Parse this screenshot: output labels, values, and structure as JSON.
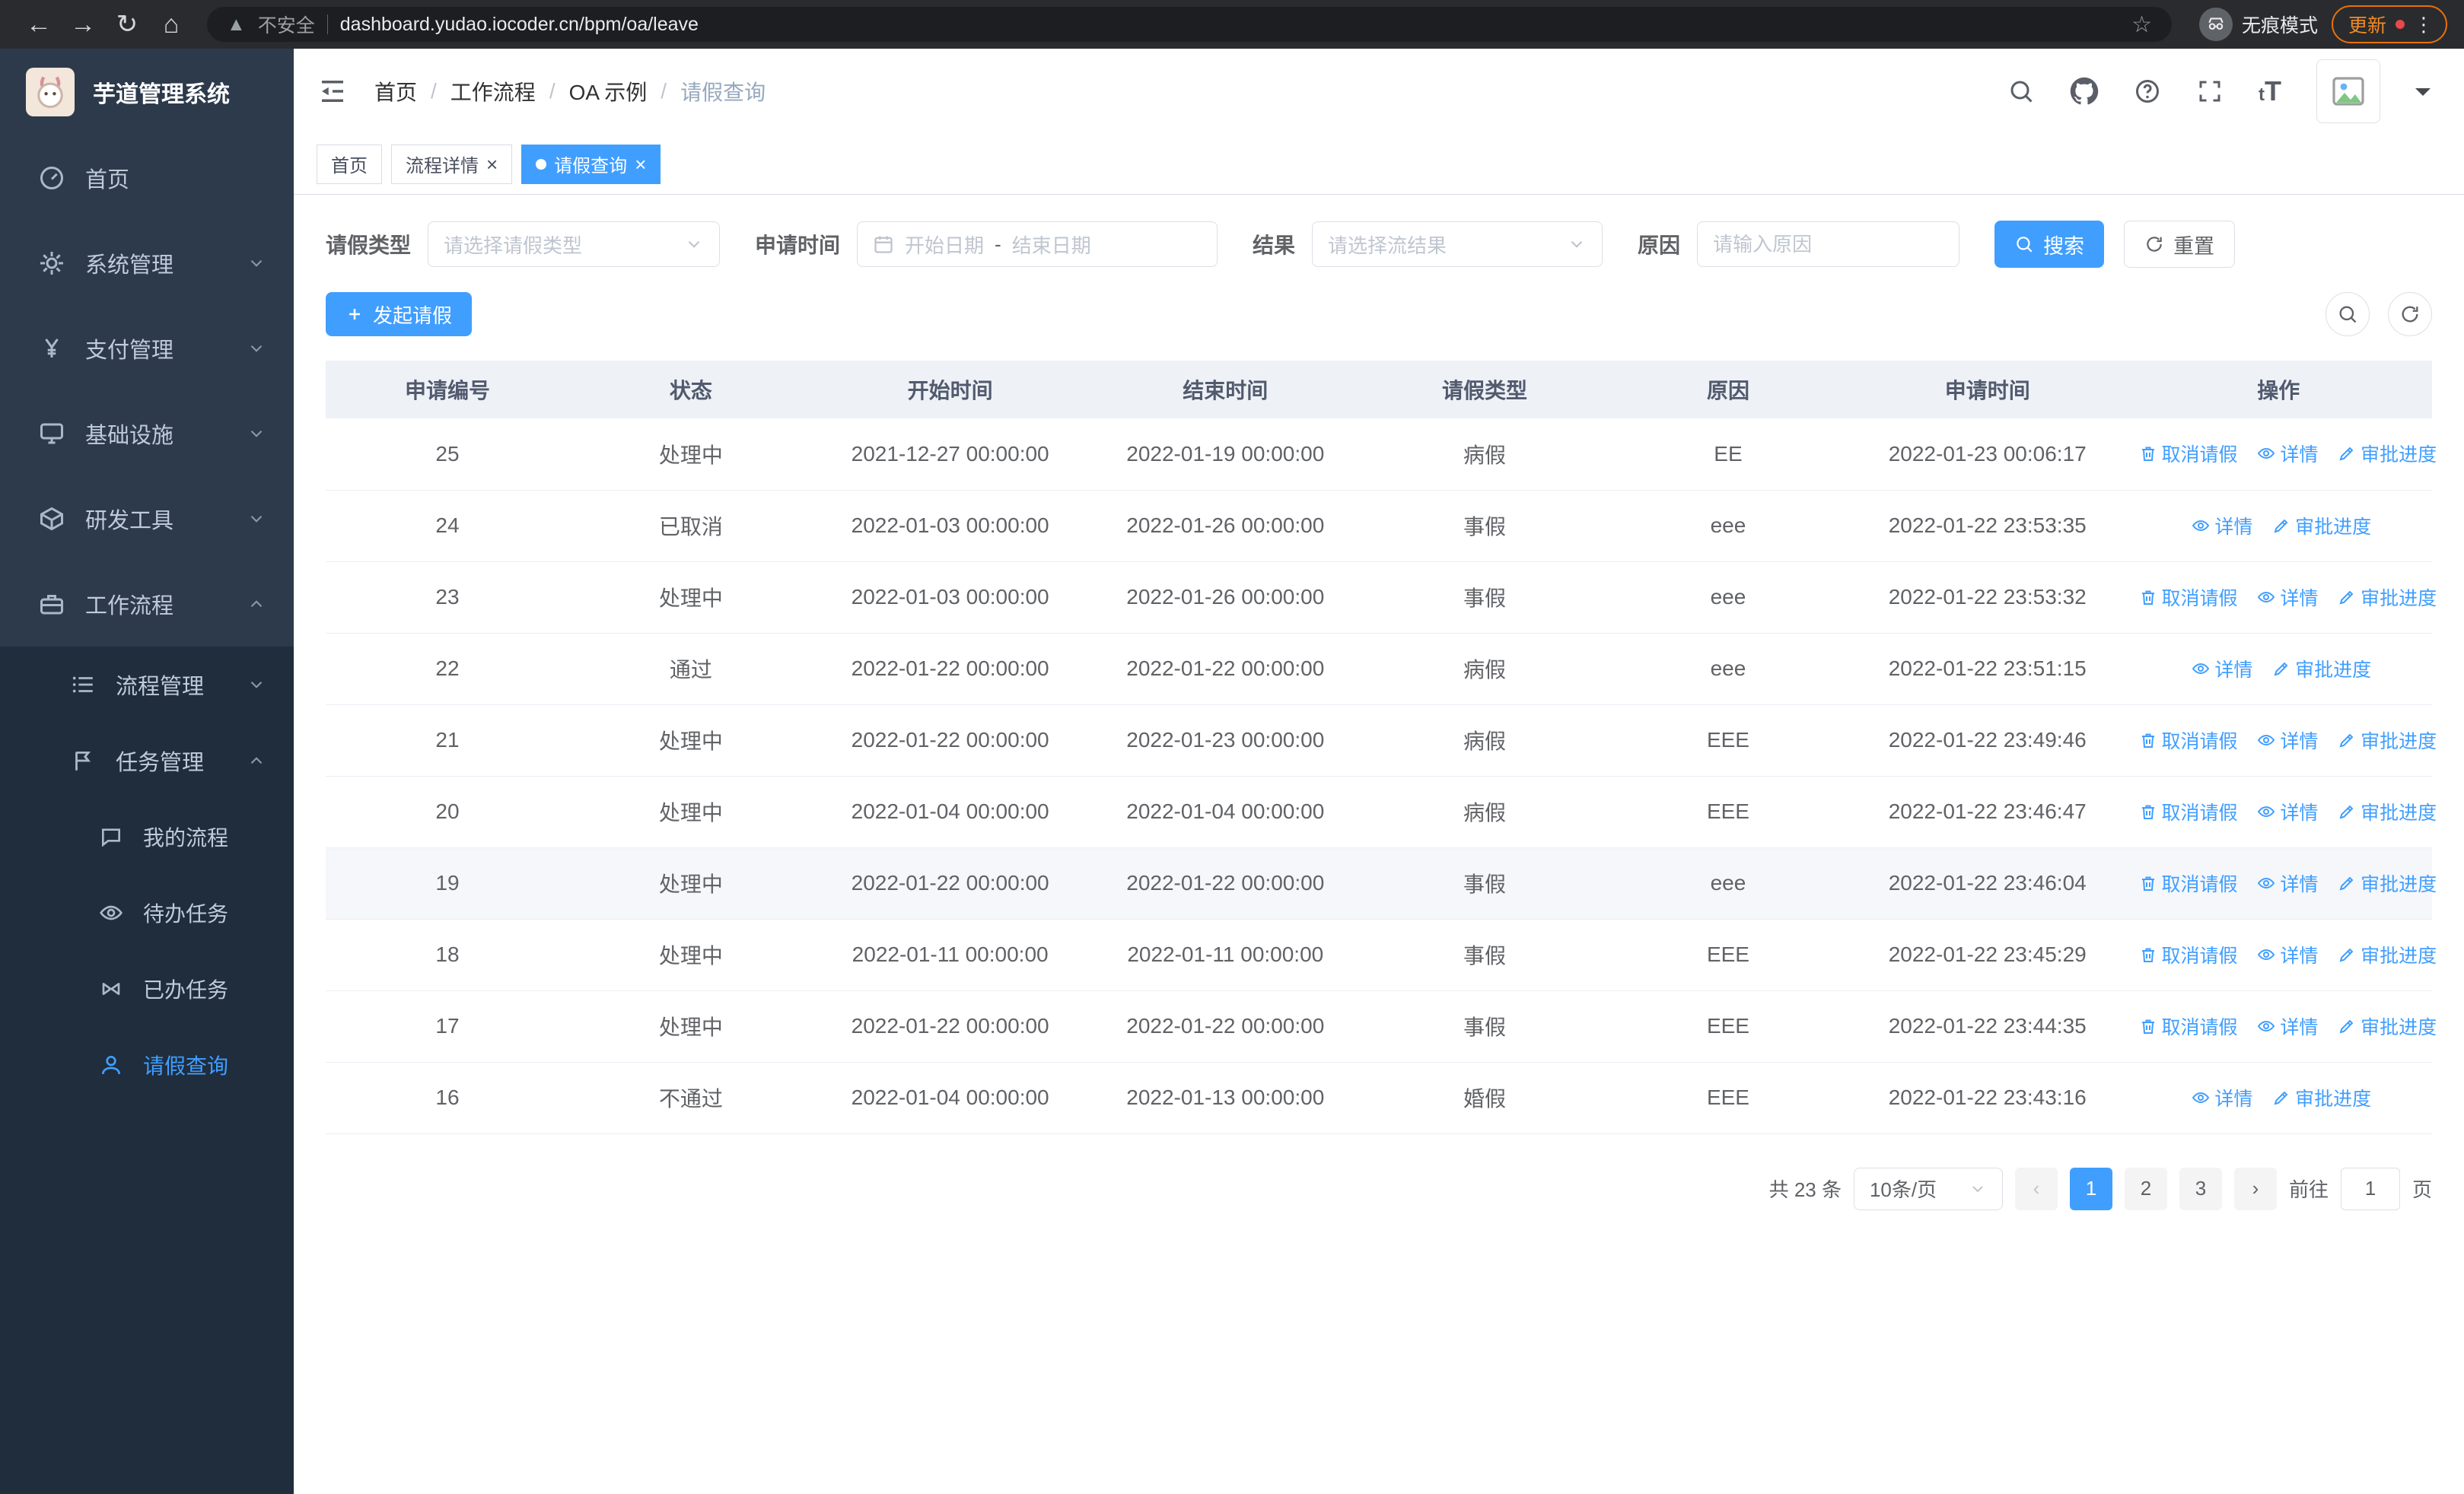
{
  "browser": {
    "security_label": "不安全",
    "url": "dashboard.yudao.iocoder.cn/bpm/oa/leave",
    "incognito_label": "无痕模式",
    "update_label": "更新"
  },
  "sidebar": {
    "app_title": "芋道管理系统",
    "items": [
      {
        "label": "首页"
      },
      {
        "label": "系统管理"
      },
      {
        "label": "支付管理"
      },
      {
        "label": "基础设施"
      },
      {
        "label": "研发工具"
      },
      {
        "label": "工作流程"
      }
    ],
    "workflow_children": [
      {
        "label": "流程管理"
      },
      {
        "label": "任务管理"
      }
    ],
    "task_children": [
      {
        "label": "我的流程"
      },
      {
        "label": "待办任务"
      },
      {
        "label": "已办任务"
      },
      {
        "label": "请假查询"
      }
    ]
  },
  "header": {
    "breadcrumb": [
      "首页",
      "工作流程",
      "OA 示例",
      "请假查询"
    ],
    "separator": "/"
  },
  "tabs": [
    {
      "label": "首页"
    },
    {
      "label": "流程详情"
    },
    {
      "label": "请假查询"
    }
  ],
  "filters": {
    "leave_type_label": "请假类型",
    "leave_type_placeholder": "请选择请假类型",
    "apply_time_label": "申请时间",
    "start_date_placeholder": "开始日期",
    "date_separator": "-",
    "end_date_placeholder": "结束日期",
    "result_label": "结果",
    "result_placeholder": "请选择流结果",
    "reason_label": "原因",
    "reason_placeholder": "请输入原因",
    "search_label": "搜索",
    "reset_label": "重置"
  },
  "toolbar": {
    "create_label": "发起请假"
  },
  "table": {
    "columns": [
      "申请编号",
      "状态",
      "开始时间",
      "结束时间",
      "请假类型",
      "原因",
      "申请时间",
      "操作"
    ],
    "actions": {
      "cancel": "取消请假",
      "detail": "详情",
      "progress": "审批进度"
    },
    "rows": [
      {
        "id": "25",
        "status": "处理中",
        "start_time": "2021-12-27 00:00:00",
        "end_time": "2022-01-19 00:00:00",
        "leave_type": "病假",
        "reason": "EE",
        "apply_time": "2022-01-23 00:06:17",
        "cancelable": true,
        "highlighted": false
      },
      {
        "id": "24",
        "status": "已取消",
        "start_time": "2022-01-03 00:00:00",
        "end_time": "2022-01-26 00:00:00",
        "leave_type": "事假",
        "reason": "eee",
        "apply_time": "2022-01-22 23:53:35",
        "cancelable": false,
        "highlighted": false
      },
      {
        "id": "23",
        "status": "处理中",
        "start_time": "2022-01-03 00:00:00",
        "end_time": "2022-01-26 00:00:00",
        "leave_type": "事假",
        "reason": "eee",
        "apply_time": "2022-01-22 23:53:32",
        "cancelable": true,
        "highlighted": false
      },
      {
        "id": "22",
        "status": "通过",
        "start_time": "2022-01-22 00:00:00",
        "end_time": "2022-01-22 00:00:00",
        "leave_type": "病假",
        "reason": "eee",
        "apply_time": "2022-01-22 23:51:15",
        "cancelable": false,
        "highlighted": false
      },
      {
        "id": "21",
        "status": "处理中",
        "start_time": "2022-01-22 00:00:00",
        "end_time": "2022-01-23 00:00:00",
        "leave_type": "病假",
        "reason": "EEE",
        "apply_time": "2022-01-22 23:49:46",
        "cancelable": true,
        "highlighted": false
      },
      {
        "id": "20",
        "status": "处理中",
        "start_time": "2022-01-04 00:00:00",
        "end_time": "2022-01-04 00:00:00",
        "leave_type": "病假",
        "reason": "EEE",
        "apply_time": "2022-01-22 23:46:47",
        "cancelable": true,
        "highlighted": false
      },
      {
        "id": "19",
        "status": "处理中",
        "start_time": "2022-01-22 00:00:00",
        "end_time": "2022-01-22 00:00:00",
        "leave_type": "事假",
        "reason": "eee",
        "apply_time": "2022-01-22 23:46:04",
        "cancelable": true,
        "highlighted": true
      },
      {
        "id": "18",
        "status": "处理中",
        "start_time": "2022-01-11 00:00:00",
        "end_time": "2022-01-11 00:00:00",
        "leave_type": "事假",
        "reason": "EEE",
        "apply_time": "2022-01-22 23:45:29",
        "cancelable": true,
        "highlighted": false
      },
      {
        "id": "17",
        "status": "处理中",
        "start_time": "2022-01-22 00:00:00",
        "end_time": "2022-01-22 00:00:00",
        "leave_type": "事假",
        "reason": "EEE",
        "apply_time": "2022-01-22 23:44:35",
        "cancelable": true,
        "highlighted": false
      },
      {
        "id": "16",
        "status": "不通过",
        "start_time": "2022-01-04 00:00:00",
        "end_time": "2022-01-13 00:00:00",
        "leave_type": "婚假",
        "reason": "EEE",
        "apply_time": "2022-01-22 23:43:16",
        "cancelable": false,
        "highlighted": false
      }
    ]
  },
  "pagination": {
    "total": "共 23 条",
    "page_size": "10条/页",
    "pages": [
      "1",
      "2",
      "3"
    ],
    "active_page": "1",
    "goto_label": "前往",
    "goto_value": "1",
    "goto_suffix": "页"
  }
}
